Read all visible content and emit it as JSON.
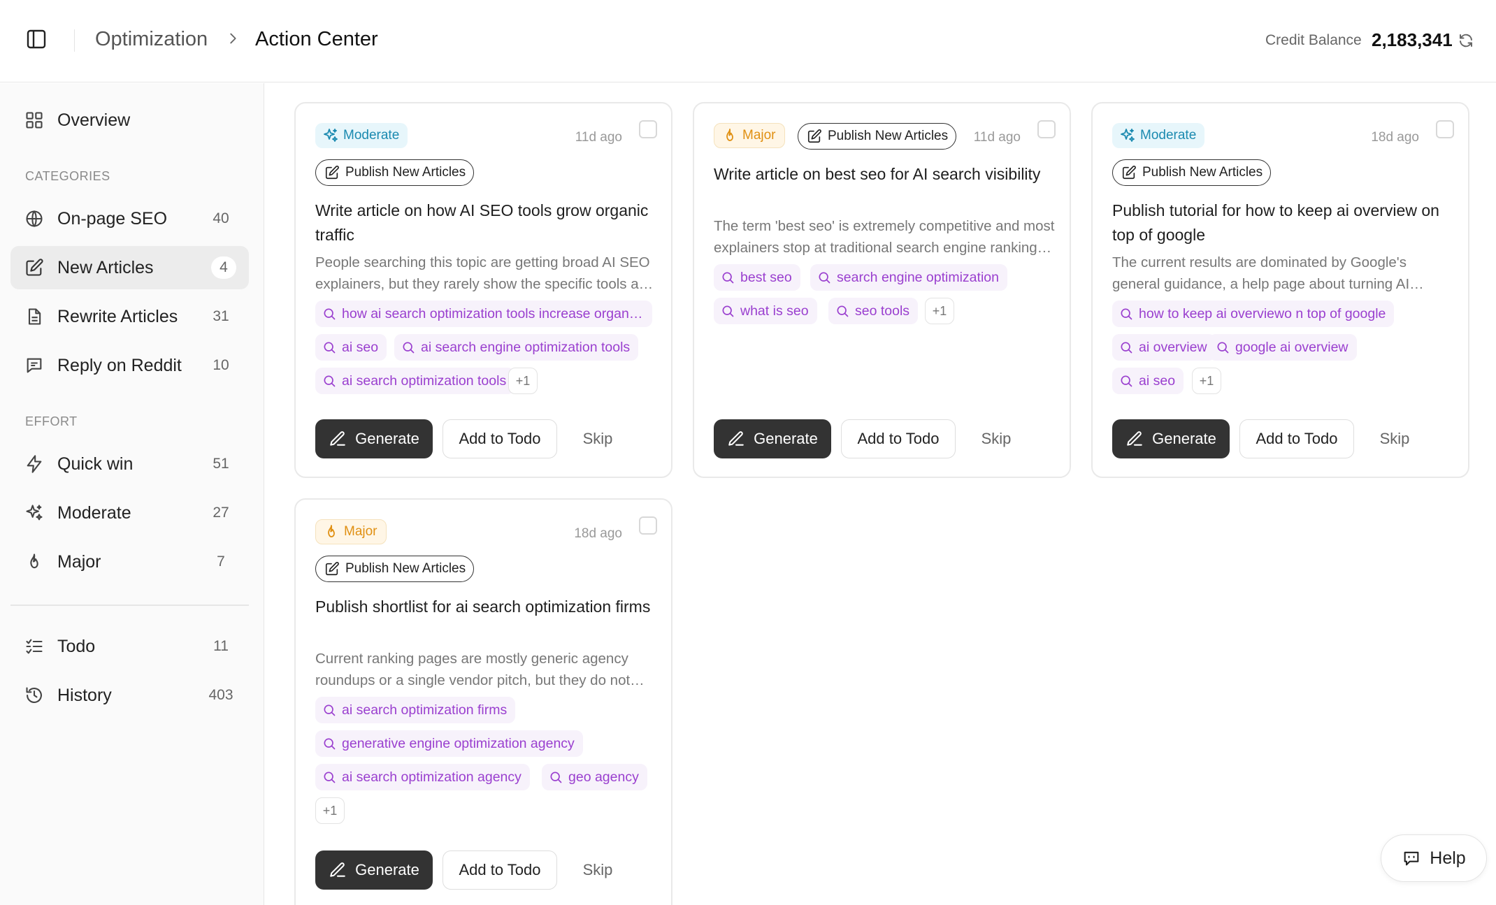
{
  "header": {
    "crumb_parent": "Optimization",
    "crumb_current": "Action Center",
    "credit_label": "Credit Balance",
    "credit_value": "2,183,341"
  },
  "sidebar": {
    "overview": "Overview",
    "categories_label": "CATEGORIES",
    "categories": [
      {
        "label": "On-page SEO",
        "count": "40",
        "icon": "globe-icon"
      },
      {
        "label": "New Articles",
        "count": "4",
        "icon": "edit-icon"
      },
      {
        "label": "Rewrite Articles",
        "count": "31",
        "icon": "document-icon"
      },
      {
        "label": "Reply on Reddit",
        "count": "10",
        "icon": "chat-icon"
      }
    ],
    "effort_label": "EFFORT",
    "effort": [
      {
        "label": "Quick win",
        "count": "51",
        "icon": "lightning-icon"
      },
      {
        "label": "Moderate",
        "count": "27",
        "icon": "sparkles-icon"
      },
      {
        "label": "Major",
        "count": "7",
        "icon": "flame-icon"
      }
    ],
    "bottom": [
      {
        "label": "Todo",
        "count": "11",
        "icon": "checklist-icon"
      },
      {
        "label": "History",
        "count": "403",
        "icon": "history-icon"
      }
    ]
  },
  "buttons": {
    "generate": "Generate",
    "add_todo": "Add to Todo",
    "skip": "Skip",
    "help": "Help"
  },
  "cards": [
    {
      "effort": "Moderate",
      "action": "Publish New Articles",
      "time": "11d ago",
      "title": "Write article on how AI SEO tools grow organic traffic",
      "desc": "People searching this topic are getting broad AI SEO explainers, but they rarely show the specific tools and workflows that drive measurable organic traffic growth.",
      "keywords": [
        "how ai search optimization tools increase organic traffic",
        "ai seo",
        "ai search engine optimization tools",
        "ai search optimization tools"
      ],
      "more": "+1"
    },
    {
      "effort": "Major",
      "action": "Publish New Articles",
      "time": "11d ago",
      "title": "Write article on best seo for AI search visibility",
      "desc": "The term 'best seo' is extremely competitive and most explainers stop at traditional search engine rankings without covering AI search visibility.",
      "keywords": [
        "best seo",
        "search engine optimization",
        "what is seo",
        "seo tools"
      ],
      "more": "+1"
    },
    {
      "effort": "Moderate",
      "action": "Publish New Articles",
      "time": "18d ago",
      "title": "Publish tutorial for how to keep ai overview on top of google",
      "desc": "The current results are dominated by Google's general guidance, a help page about turning AI overviews off, and forum threads with scattered tips.",
      "keywords": [
        "how to keep ai overviewo n top of google",
        "ai overview",
        "google ai overview",
        "ai seo"
      ],
      "more": "+1"
    },
    {
      "effort": "Major",
      "action": "Publish New Articles",
      "time": "18d ago",
      "title": "Publish shortlist for ai search optimization firms",
      "desc": "Current ranking pages are mostly generic agency roundups or a single vendor pitch, but they do not compare firms by proven AI search results.",
      "keywords": [
        "ai search optimization firms",
        "generative engine optimization agency",
        "ai search optimization agency",
        "geo agency"
      ],
      "more": "+1"
    }
  ]
}
